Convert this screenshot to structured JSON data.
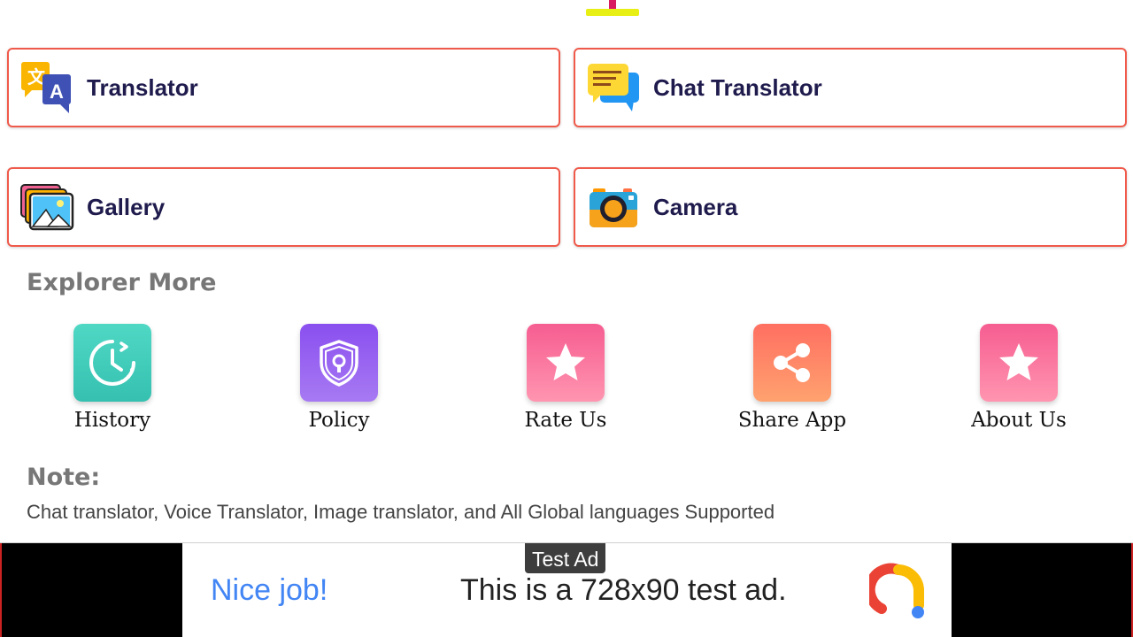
{
  "cards": [
    {
      "label": "Translator",
      "icon": "translate-icon"
    },
    {
      "label": "Chat Translator",
      "icon": "chat-bubbles-icon"
    },
    {
      "label": "Gallery",
      "icon": "gallery-icon"
    },
    {
      "label": "Camera",
      "icon": "camera-icon"
    }
  ],
  "explore": {
    "title": "Explorer More",
    "items": [
      {
        "label": "History",
        "icon": "history-clock-icon"
      },
      {
        "label": "Policy",
        "icon": "shield-lock-icon"
      },
      {
        "label": "Rate Us",
        "icon": "star-icon"
      },
      {
        "label": "Share App",
        "icon": "share-icon"
      },
      {
        "label": "About Us",
        "icon": "star-icon"
      }
    ]
  },
  "note": {
    "title": "Note:",
    "text": "Chat translator, Voice Translator, Image translator, and All Global languages Supported"
  },
  "ad": {
    "badge": "Test Ad",
    "headline": "Nice job!",
    "text": "This is a 728x90 test ad."
  },
  "colors": {
    "card_border": "#ef5a4b",
    "label_text": "#1f1b4d",
    "section_gray": "#777777",
    "history_tile": "#3ec9b8",
    "policy_tile": "#8e5cf0",
    "rate_tile": "#f76b9a",
    "share_tile": "#ff7a5c",
    "ad_link": "#4285f4"
  }
}
